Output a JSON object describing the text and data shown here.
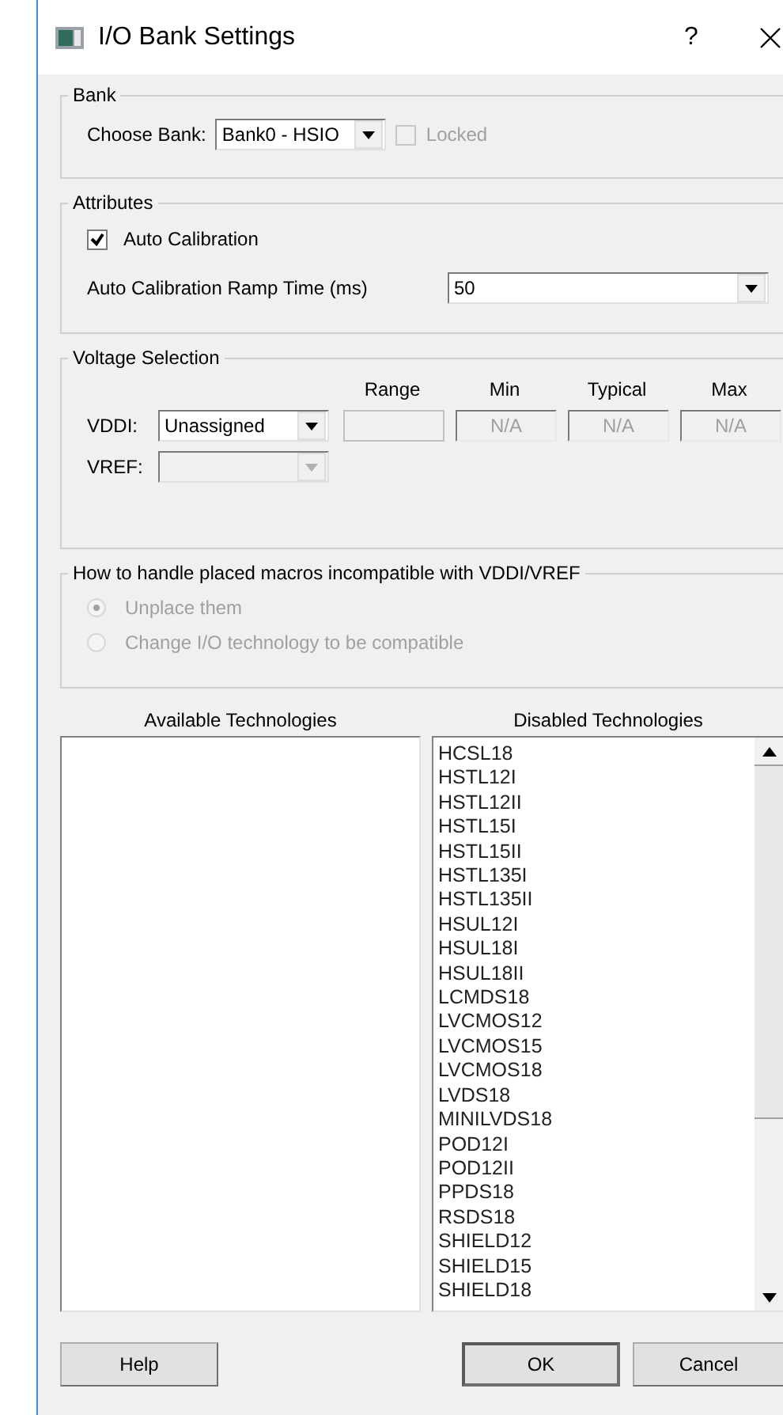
{
  "window": {
    "title": "I/O Bank Settings",
    "help_glyph": "?"
  },
  "bank": {
    "legend": "Bank",
    "choose_label": "Choose Bank:",
    "value": "Bank0 - HSIO",
    "locked": {
      "label": "Locked",
      "checked": false,
      "disabled": true
    }
  },
  "attributes": {
    "legend": "Attributes",
    "auto_calibration": {
      "label": "Auto Calibration",
      "checked": true
    },
    "ramp_label": "Auto Calibration Ramp Time (ms)",
    "ramp_value": "50"
  },
  "voltage": {
    "legend": "Voltage Selection",
    "columns": [
      "Range",
      "Min",
      "Typical",
      "Max"
    ],
    "vddi": {
      "label": "VDDI:",
      "value": "Unassigned",
      "fields": [
        {
          "disabled": false
        },
        {
          "value": "N/A",
          "disabled": true
        },
        {
          "value": "N/A",
          "disabled": true
        },
        {
          "value": "N/A",
          "disabled": true
        }
      ]
    },
    "vref": {
      "label": "VREF:",
      "disabled": true
    }
  },
  "macros": {
    "legend": "How to handle placed macros incompatible with VDDI/VREF",
    "disabled": true,
    "options": [
      {
        "label": "Unplace them",
        "selected": true
      },
      {
        "label": "Change I/O technology to be compatible",
        "selected": false
      }
    ]
  },
  "available": {
    "heading": "Available Technologies"
  },
  "disabled_list": {
    "heading": "Disabled Technologies",
    "items": [
      "HCSL18",
      "HSTL12I",
      "HSTL12II",
      "HSTL15I",
      "HSTL15II",
      "HSTL135I",
      "HSTL135II",
      "HSUL12I",
      "HSUL18I",
      "HSUL18II",
      "LCMDS18",
      "LVCMOS12",
      "LVCMOS15",
      "LVCMOS18",
      "LVDS18",
      "MINILVDS18",
      "POD12I",
      "POD12II",
      "PPDS18",
      "RSDS18",
      "SHIELD12",
      "SHIELD15",
      "SHIELD18"
    ]
  },
  "buttons": [
    {
      "label": "Help",
      "default": false
    },
    {
      "label": "OK",
      "default": true
    },
    {
      "label": "Cancel",
      "default": false
    }
  ]
}
